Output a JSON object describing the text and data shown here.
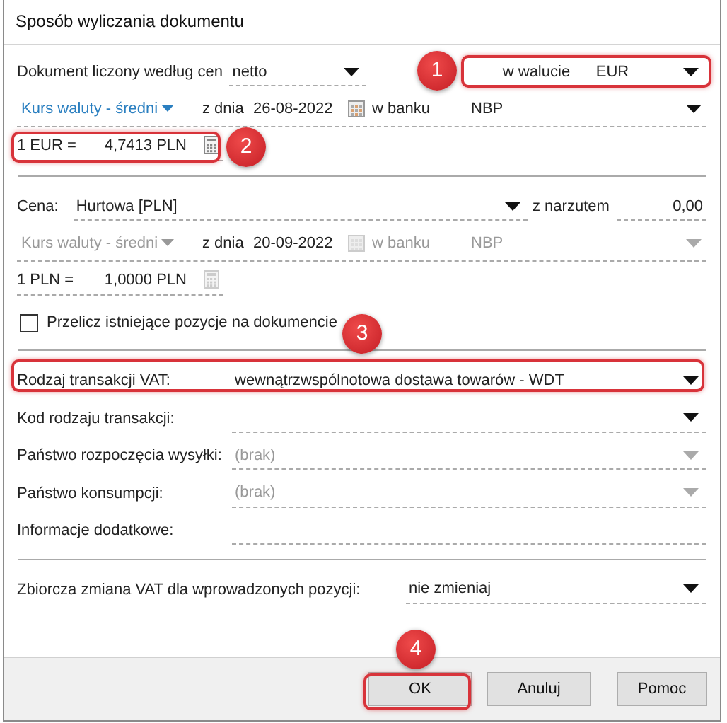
{
  "window": {
    "title": "Sposób wyliczania dokumentu"
  },
  "document_prices": {
    "label": "Dokument liczony według cen",
    "value": "netto",
    "currency_label": "w walucie",
    "currency": "EUR"
  },
  "rates": [
    {
      "type": "Kurs waluty - średni",
      "date_label": "z dnia",
      "date": "26-08-2022",
      "bank_label": "w banku",
      "bank": "NBP",
      "disabled": false,
      "conversion": "1 EUR =",
      "amount": "4,7413 PLN"
    },
    {
      "type": "Kurs waluty - średni",
      "date_label": "z dnia",
      "date": "20-09-2022",
      "bank_label": "w banku",
      "bank": "NBP",
      "disabled": true,
      "conversion": "1 PLN =",
      "amount": "1,0000 PLN"
    }
  ],
  "price": {
    "label": "Cena:",
    "value": "Hurtowa [PLN]",
    "markup_label": "z narzutem",
    "markup": "0,00"
  },
  "recalculate": {
    "label": "Przelicz istniejące pozycje na dokumencie",
    "checked": false
  },
  "vat_fields": [
    {
      "label": "Rodzaj transakcji VAT:",
      "value": "wewnątrzwspólnotowa dostawa towarów - WDT",
      "kind": "dropdown",
      "disabled": false
    },
    {
      "label": "Kod rodzaju transakcji:",
      "kind": "dropdown",
      "disabled": false
    },
    {
      "label": "Państwo rozpoczęcia wysyłki:",
      "value": "(brak)",
      "kind": "dropdown",
      "disabled": true
    },
    {
      "label": "Państwo konsumpcji:",
      "value": "(brak)",
      "kind": "dropdown",
      "disabled": true
    },
    {
      "label": "Informacje dodatkowe:",
      "kind": "text"
    }
  ],
  "bulk_vat": {
    "label": "Zbiorcza zmiana VAT dla wprowadzonych pozycji:",
    "value": "nie zmieniaj"
  },
  "buttons": [
    {
      "label": "OK"
    },
    {
      "label": "Anuluj"
    },
    {
      "label": "Pomoc"
    }
  ],
  "callouts": [
    {
      "number": "1"
    },
    {
      "number": "2"
    },
    {
      "number": "3"
    },
    {
      "number": "4"
    }
  ]
}
